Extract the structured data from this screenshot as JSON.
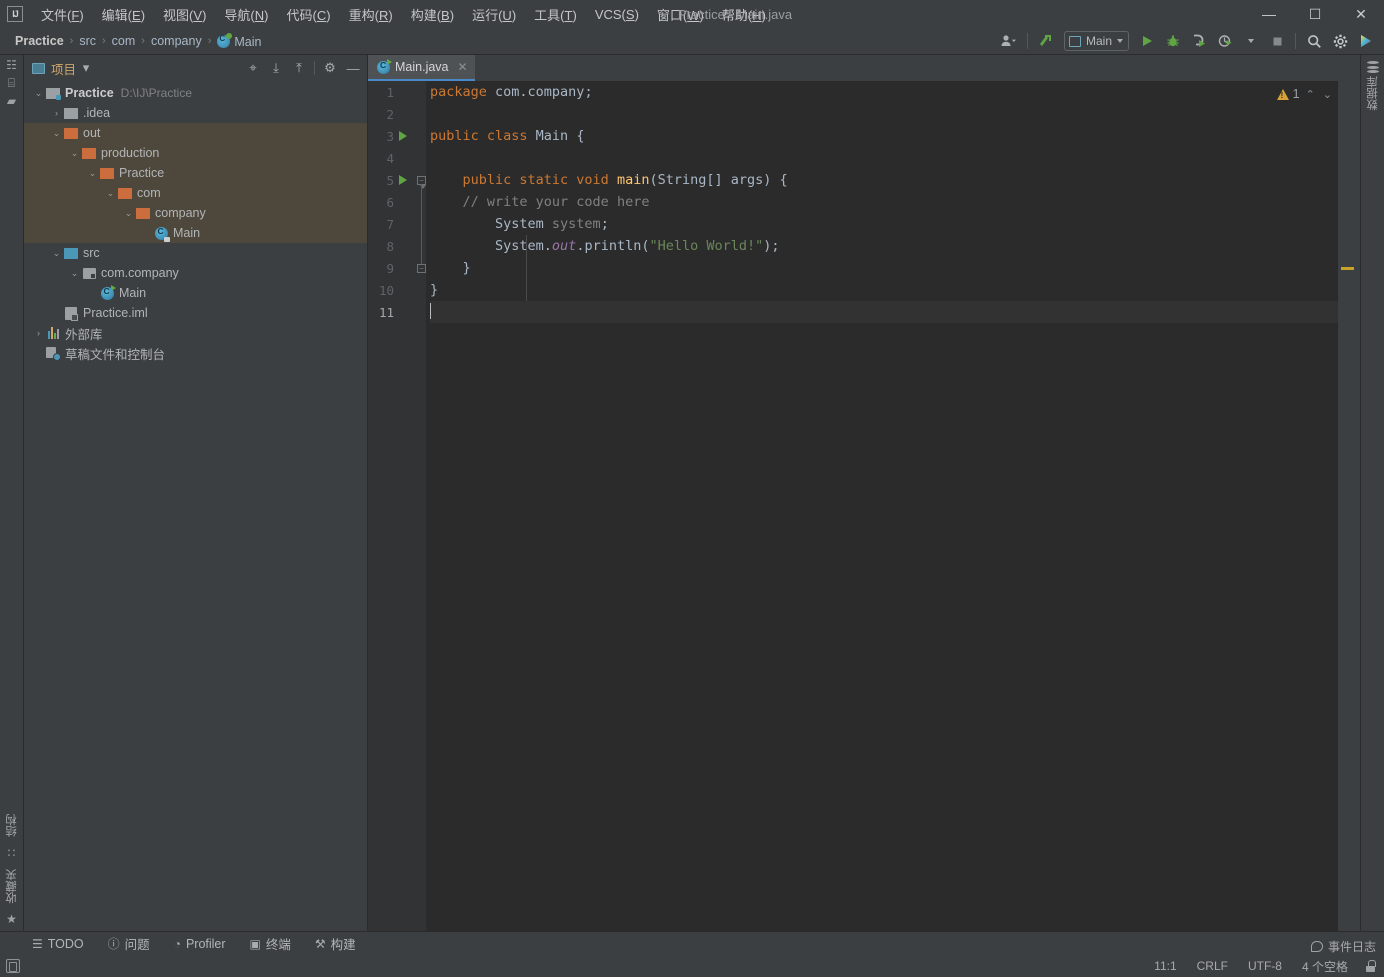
{
  "window": {
    "title": "Practice - Main.java",
    "logo": "ij-logo",
    "controls": {
      "minimize": "—",
      "maximize": "☐",
      "close": "✕"
    }
  },
  "menubar": [
    {
      "label": "文件",
      "mnemonic": "F"
    },
    {
      "label": "编辑",
      "mnemonic": "E"
    },
    {
      "label": "视图",
      "mnemonic": "V"
    },
    {
      "label": "导航",
      "mnemonic": "N"
    },
    {
      "label": "代码",
      "mnemonic": "C"
    },
    {
      "label": "重构",
      "mnemonic": "R"
    },
    {
      "label": "构建",
      "mnemonic": "B"
    },
    {
      "label": "运行",
      "mnemonic": "U"
    },
    {
      "label": "工具",
      "mnemonic": "T"
    },
    {
      "label": "VCS",
      "mnemonic": "S"
    },
    {
      "label": "窗口",
      "mnemonic": "W"
    },
    {
      "label": "帮助",
      "mnemonic": "H"
    }
  ],
  "breadcrumb": {
    "items": [
      "Practice",
      "src",
      "com",
      "company",
      "Main"
    ],
    "separator": "›"
  },
  "toolbar": {
    "user_icon": "user-avatar-icon",
    "update_icon": "update-project-icon",
    "run_config": "Main",
    "run_icon": "run-icon",
    "debug_icon": "debug-icon",
    "run_with_coverage_icon": "run-coverage-icon",
    "profile_icon": "profile-icon",
    "stop_icon": "stop-icon",
    "search_icon": "search-everywhere-icon",
    "settings_icon": "settings-gear-icon",
    "ide_icon": "ide-helper-icon"
  },
  "project_panel": {
    "title": "项目",
    "title_icon": "project-view-icon",
    "dropdown_caret": "▾",
    "header_icons": [
      {
        "name": "scroll-from-source-icon",
        "glyph": "⌖"
      },
      {
        "name": "expand-all-icon",
        "glyph": "⤓"
      },
      {
        "name": "collapse-all-icon",
        "glyph": "⤒"
      },
      {
        "name": "settings-gear-icon",
        "glyph": "⚙"
      },
      {
        "name": "hide-panel-icon",
        "glyph": "—"
      }
    ],
    "tree": [
      {
        "label": "Practice",
        "sub": "D:\\IJ\\Practice",
        "icon": "project-folder",
        "indent": 0,
        "twist": "⌄",
        "bold": true,
        "highlight": false
      },
      {
        "label": ".idea",
        "sub": "",
        "icon": "folder-gray",
        "indent": 1,
        "twist": "›",
        "bold": false,
        "highlight": false
      },
      {
        "label": "out",
        "sub": "",
        "icon": "folder-orange",
        "indent": 1,
        "twist": "⌄",
        "bold": false,
        "highlight": true
      },
      {
        "label": "production",
        "sub": "",
        "icon": "folder-orange",
        "indent": 2,
        "twist": "⌄",
        "bold": false,
        "highlight": true
      },
      {
        "label": "Practice",
        "sub": "",
        "icon": "folder-orange",
        "indent": 3,
        "twist": "⌄",
        "bold": false,
        "highlight": true
      },
      {
        "label": "com",
        "sub": "",
        "icon": "folder-orange",
        "indent": 4,
        "twist": "⌄",
        "bold": false,
        "highlight": true
      },
      {
        "label": "company",
        "sub": "",
        "icon": "folder-orange",
        "indent": 5,
        "twist": "⌄",
        "bold": false,
        "highlight": true
      },
      {
        "label": "Main",
        "sub": "",
        "icon": "class-compiled",
        "indent": 6,
        "twist": "",
        "bold": false,
        "highlight": true
      },
      {
        "label": "src",
        "sub": "",
        "icon": "folder-blue",
        "indent": 1,
        "twist": "⌄",
        "bold": false,
        "highlight": false
      },
      {
        "label": "com.company",
        "sub": "",
        "icon": "package",
        "indent": 2,
        "twist": "⌄",
        "bold": false,
        "highlight": false
      },
      {
        "label": "Main",
        "sub": "",
        "icon": "class-runnable",
        "indent": 3,
        "twist": "",
        "bold": false,
        "highlight": false
      },
      {
        "label": "Practice.iml",
        "sub": "",
        "icon": "iml-file",
        "indent": 1,
        "twist": "",
        "bold": false,
        "highlight": false
      },
      {
        "label": "外部库",
        "sub": "",
        "icon": "library",
        "indent": 0,
        "twist": "›",
        "bold": false,
        "highlight": false
      },
      {
        "label": "草稿文件和控制台",
        "sub": "",
        "icon": "scratch",
        "indent": 0,
        "twist": "",
        "bold": false,
        "highlight": false
      }
    ]
  },
  "left_strip": {
    "top_icons": [
      {
        "name": "project-tool-icon",
        "glyph": "☷"
      },
      {
        "name": "commit-tool-icon",
        "glyph": "⌸"
      },
      {
        "name": "folder-tool-icon",
        "glyph": "▰"
      }
    ],
    "bottom_items": [
      {
        "name": "structure-tool",
        "label": "结构",
        "glyph": "∷"
      },
      {
        "name": "favorites-tool",
        "label": "收藏夹",
        "glyph": "★"
      }
    ]
  },
  "right_strip": {
    "items": [
      {
        "name": "database-tool",
        "label": "数据库",
        "glyph": "database-icon"
      }
    ]
  },
  "editor": {
    "tab": {
      "label": "Main.java",
      "icon": "java-class-runnable-icon",
      "close": "✕"
    },
    "inspection": {
      "warn_count": "1",
      "prev": "⌃",
      "next": "⌄"
    },
    "cursor_line": 11,
    "lines": [
      {
        "n": 1,
        "run": false,
        "fold": "",
        "tokens": [
          {
            "t": "kw",
            "v": "package"
          },
          {
            "t": "txt",
            "v": " com.company;"
          }
        ]
      },
      {
        "n": 2,
        "run": false,
        "fold": "",
        "tokens": []
      },
      {
        "n": 3,
        "run": true,
        "fold": "",
        "tokens": [
          {
            "t": "kw",
            "v": "public class"
          },
          {
            "t": "txt",
            "v": " Main {"
          }
        ]
      },
      {
        "n": 4,
        "run": false,
        "fold": "",
        "tokens": []
      },
      {
        "n": 5,
        "run": true,
        "fold": "open",
        "tokens": [
          {
            "t": "txt",
            "v": "    "
          },
          {
            "t": "kw",
            "v": "public static void"
          },
          {
            "t": "txt",
            "v": " "
          },
          {
            "t": "mth",
            "v": "main"
          },
          {
            "t": "txt",
            "v": "(String[] args) {"
          }
        ]
      },
      {
        "n": 6,
        "run": false,
        "fold": "",
        "tokens": [
          {
            "t": "txt",
            "v": "    "
          },
          {
            "t": "cmt",
            "v": "// write your code here"
          }
        ]
      },
      {
        "n": 7,
        "run": false,
        "fold": "",
        "tokens": [
          {
            "t": "txt",
            "v": "        System "
          },
          {
            "t": "cmt",
            "v": "system"
          },
          {
            "t": "txt",
            "v": ";"
          }
        ]
      },
      {
        "n": 8,
        "run": false,
        "fold": "",
        "tokens": [
          {
            "t": "txt",
            "v": "        System."
          },
          {
            "t": "fld",
            "v": "out"
          },
          {
            "t": "txt",
            "v": ".println("
          },
          {
            "t": "str",
            "v": "\"Hello World!\""
          },
          {
            "t": "txt",
            "v": ");"
          }
        ]
      },
      {
        "n": 9,
        "run": false,
        "fold": "close",
        "tokens": [
          {
            "t": "txt",
            "v": "    }"
          }
        ]
      },
      {
        "n": 10,
        "run": false,
        "fold": "",
        "tokens": [
          {
            "t": "txt",
            "v": "}"
          }
        ]
      },
      {
        "n": 11,
        "run": false,
        "fold": "",
        "tokens": []
      }
    ]
  },
  "bottom_bar": [
    {
      "name": "todo",
      "label": "TODO",
      "glyph": "☰"
    },
    {
      "name": "problems",
      "label": "问题",
      "glyph": "ⓘ"
    },
    {
      "name": "profiler",
      "label": "Profiler",
      "glyph": "◔"
    },
    {
      "name": "terminal",
      "label": "终端",
      "glyph": "▣"
    },
    {
      "name": "build",
      "label": "构建",
      "glyph": "⚒"
    }
  ],
  "status_bar": {
    "event_log": "事件日志",
    "event_log_icon": "balloon-icon",
    "position": "11:1",
    "line_separator": "CRLF",
    "encoding": "UTF-8",
    "indent": "4 个空格",
    "lock_icon": "lock-icon",
    "left_icon": "show-tool-windows-icon"
  },
  "colors": {
    "chrome": "#3c3f41",
    "editor_bg": "#2b2b2b",
    "gutter_bg": "#313335",
    "excluded_row": "#4e473c",
    "tab_active": "#4e5254",
    "tab_underline": "#4a88c7",
    "keyword": "#cc7832",
    "string": "#6a8759",
    "comment": "#808080",
    "field": "#9876aa",
    "method": "#ffc66d",
    "text": "#a9b7c6",
    "warning": "#d6a138",
    "run_green": "#5fa544",
    "folder_orange": "#cc6d3e",
    "folder_blue": "#4b97b8"
  }
}
